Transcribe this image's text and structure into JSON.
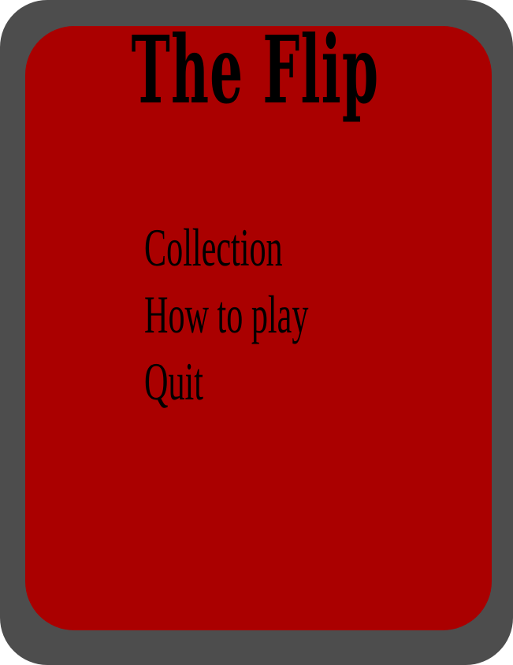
{
  "game": {
    "title": "The Flip"
  },
  "menu": {
    "items": [
      {
        "label": "Collection"
      },
      {
        "label": "How to play"
      },
      {
        "label": "Quit"
      }
    ]
  },
  "colors": {
    "frame": "#4d4d4d",
    "face": "#aa0000",
    "text": "#000000"
  }
}
